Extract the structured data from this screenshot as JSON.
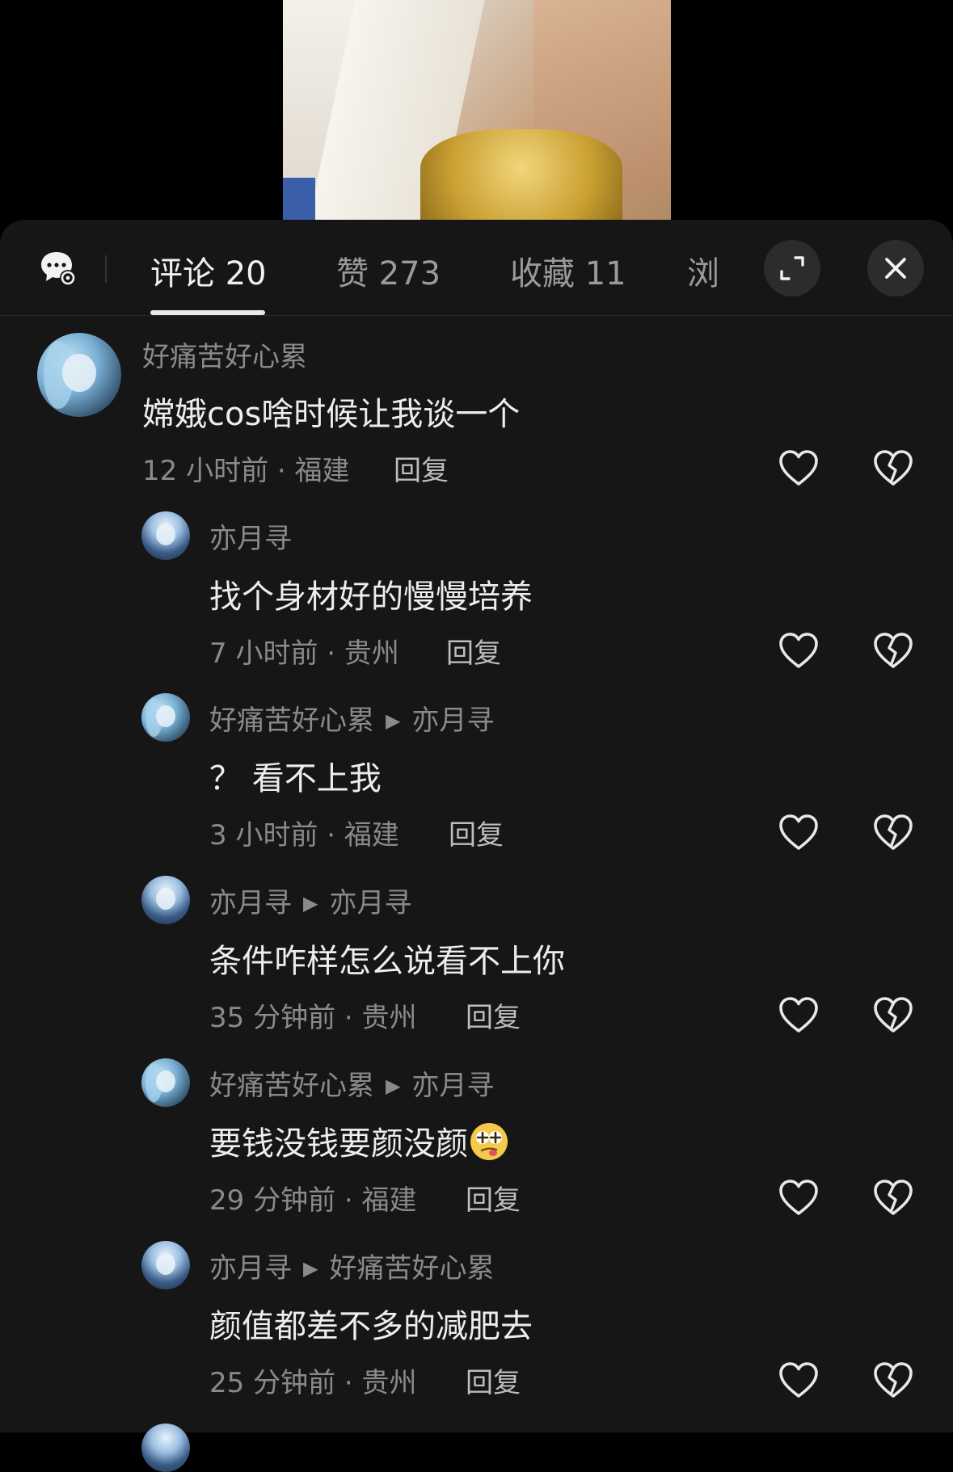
{
  "tabs": {
    "comments": "评论 20",
    "likes": "赞 273",
    "favorites": "收藏 11",
    "views": "浏"
  },
  "icons": {
    "chat_settings": "chat-settings-icon",
    "expand": "expand-icon",
    "close": "close-icon",
    "like": "heart-icon",
    "dislike": "broken-heart-icon"
  },
  "comments": [
    {
      "user": "好痛苦好心累",
      "reply_to": "",
      "text": "嫦娥cos啥时候让我谈一个",
      "meta": "12 小时前 · 福建",
      "reply_label": "回复"
    },
    {
      "user": "亦月寻",
      "reply_to": "",
      "text": "找个身材好的慢慢培养",
      "meta": "7 小时前 · 贵州",
      "reply_label": "回复"
    },
    {
      "user": "好痛苦好心累",
      "reply_to": "亦月寻",
      "text": "？ 看不上我",
      "meta": "3 小时前 · 福建",
      "reply_label": "回复"
    },
    {
      "user": "亦月寻",
      "reply_to": "亦月寻",
      "text": "条件咋样怎么说看不上你",
      "meta": "35 分钟前 · 贵州",
      "reply_label": "回复"
    },
    {
      "user": "好痛苦好心累",
      "reply_to": "亦月寻",
      "text": "要钱没钱要颜没颜",
      "meta": "29 分钟前 · 福建",
      "reply_label": "回复"
    },
    {
      "user": "亦月寻",
      "reply_to": "好痛苦好心累",
      "text": "颜值都差不多的减肥去",
      "meta": "25 分钟前 · 贵州",
      "reply_label": "回复"
    }
  ]
}
